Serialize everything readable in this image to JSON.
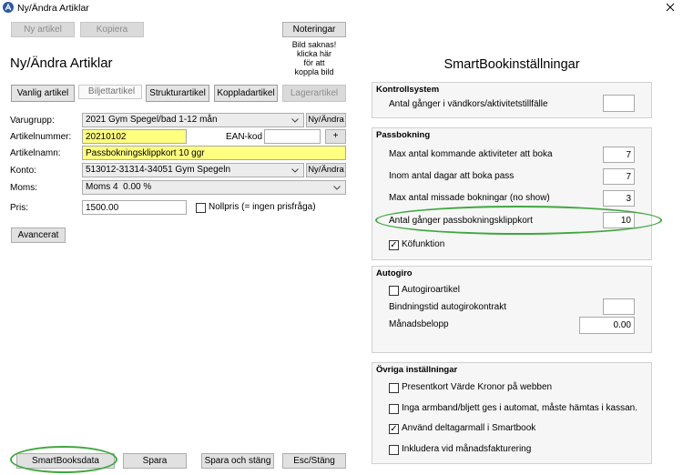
{
  "window": {
    "title": "Ny/Ändra Artiklar"
  },
  "icons": {
    "app": "app-icon",
    "close": "close-icon",
    "dropdown": "chevron-down-icon",
    "check": "checkmark-icon"
  },
  "colors": {
    "required_field": "#ffff80",
    "highlight_ring": "#3fa83f",
    "button_face": "#e1e1e1"
  },
  "toolbar": {
    "new_label": "Ny artikel",
    "new_enabled": false,
    "copy_label": "Kopiera",
    "copy_enabled": false,
    "notes_label": "Noteringar"
  },
  "image_placeholder": [
    "Bild saknas!",
    "klicka här",
    "för att",
    "koppla bild"
  ],
  "heading": "Ny/Ändra Artiklar",
  "tabs": [
    {
      "label": "Vanlig artikel"
    },
    {
      "label": "Biljettartikel",
      "selected": true
    },
    {
      "label": "Strukturartikel"
    },
    {
      "label": "Koppladartikel"
    },
    {
      "label": "Lagerartikel",
      "enabled": false
    }
  ],
  "form": {
    "varugrupp": {
      "label": "Varugrupp:",
      "value": "2021 Gym Spegel/bad 1-12 mån",
      "button": "Ny/Ändra"
    },
    "artikelnummer": {
      "label": "Artikelnummer:",
      "value": "20210102"
    },
    "ean": {
      "label": "EAN-kod",
      "value": "",
      "button": "+"
    },
    "artikelnamn": {
      "label": "Artikelnamn:",
      "value": "Passbokningsklippkort 10 ggr"
    },
    "konto": {
      "label": "Konto:",
      "value": "513012-31314-34051 Gym Spegeln",
      "button": "Ny/Ändra"
    },
    "moms": {
      "label": "Moms:",
      "value": "Moms 4  0.00 %"
    },
    "pris": {
      "label": "Pris:",
      "value": "1500.00"
    },
    "nollpris": {
      "label": "Nollpris (= ingen prisfråga)",
      "checked": false
    },
    "advanced_label": "Avancerat"
  },
  "footer": {
    "smartbook_label": "SmartBooksdata",
    "save_label": "Spara",
    "save_close_label": "Spara och stäng",
    "close_label": "Esc/Stäng"
  },
  "smartbook": {
    "title": "SmartBookinställningar",
    "kontrollsystem": {
      "title": "Kontrollsystem",
      "fields": [
        {
          "label": "Antal gånger i vändkors/aktivitetstillfälle",
          "value": ""
        }
      ]
    },
    "passbokning": {
      "title": "Passbokning",
      "fields": [
        {
          "label": "Max antal kommande aktiviteter att boka",
          "value": "7"
        },
        {
          "label": "Inom antal dagar att boka pass",
          "value": "7"
        },
        {
          "label": "Max antal missade bokningar (no show)",
          "value": "3"
        },
        {
          "label": "Antal gånger passbokningsklippkort",
          "value": "10"
        }
      ],
      "queue": {
        "label": "Köfunktion",
        "checked": true
      }
    },
    "autogiro": {
      "title": "Autogiro",
      "autogiro_article": {
        "label": "Autogiroartikel",
        "checked": false
      },
      "fields": [
        {
          "label": "Bindningstid autogirokontrakt",
          "value": ""
        },
        {
          "label": "Månadsbelopp",
          "value": "0.00"
        }
      ]
    },
    "ovriga": {
      "title": "Övriga inställningar",
      "options": [
        {
          "label": "Presentkort Värde Kronor på webben",
          "checked": false
        },
        {
          "label": "Inga armband/bljett ges i automat, måste hämtas i kassan.",
          "checked": false
        },
        {
          "label": "Använd deltagarmall i Smartbook",
          "checked": true
        },
        {
          "label": "Inkludera vid månadsfakturering",
          "checked": false
        }
      ]
    }
  }
}
